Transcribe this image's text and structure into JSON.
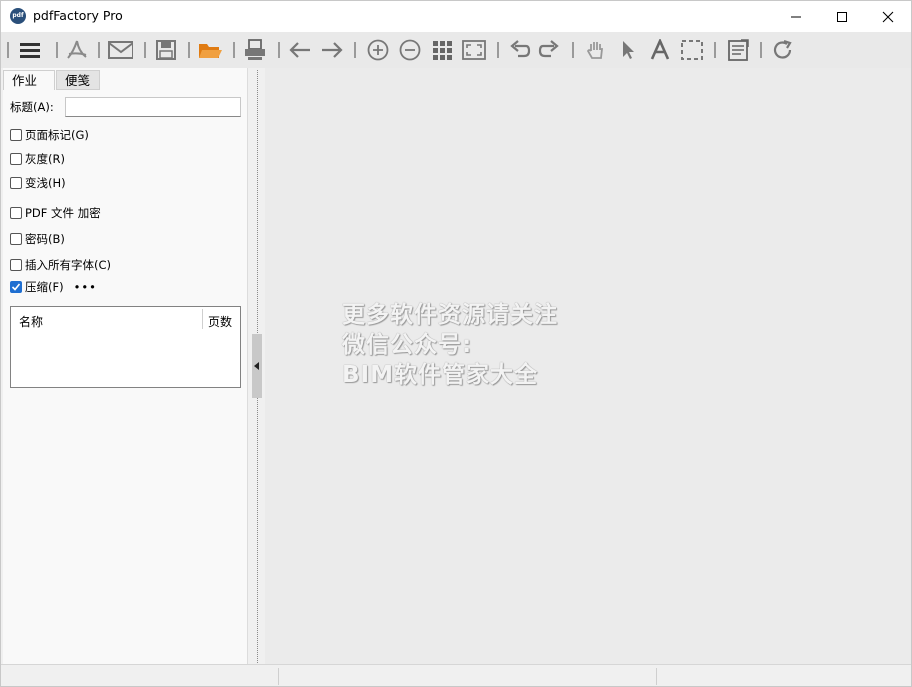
{
  "window": {
    "app_icon_text": "pdf",
    "title": "pdfFactory Pro"
  },
  "toolbar": {
    "icons": [
      "menu-icon",
      "acrobat-icon",
      "envelope-icon",
      "save-icon",
      "open-folder-icon",
      "printer-icon",
      "arrow-left-icon",
      "arrow-right-icon",
      "zoom-in-icon",
      "zoom-out-icon",
      "grid-view-icon",
      "fit-page-icon",
      "undo-icon",
      "redo-icon",
      "hand-tool-icon",
      "pointer-icon",
      "text-tool-icon",
      "select-area-icon",
      "notes-icon",
      "refresh-icon"
    ]
  },
  "tabs": {
    "job": "作业",
    "notes": "便笺"
  },
  "form": {
    "title_label": "标题(A):",
    "title_value": "",
    "page_marks": "页面标记(G)",
    "grayscale": "灰度(R)",
    "lighten": "变浅(H)",
    "pdf_encrypt": "PDF 文件 加密",
    "password": "密码(B)",
    "embed_fonts": "插入所有字体(C)",
    "compress": "压缩(F)",
    "more": "•••"
  },
  "checkboxes": {
    "page_marks": false,
    "grayscale": false,
    "lighten": false,
    "pdf_encrypt": false,
    "password": false,
    "embed_fonts": false,
    "compress": true
  },
  "list": {
    "col_name": "名称",
    "col_pages": "页数"
  },
  "watermark": {
    "line1": "更多软件资源请关注",
    "line2": "微信公众号:",
    "line3": "BIM软件管家大全"
  },
  "colors": {
    "accent": "#1f6fd1",
    "folder": "#e07b12",
    "icon_gray": "#555555"
  }
}
